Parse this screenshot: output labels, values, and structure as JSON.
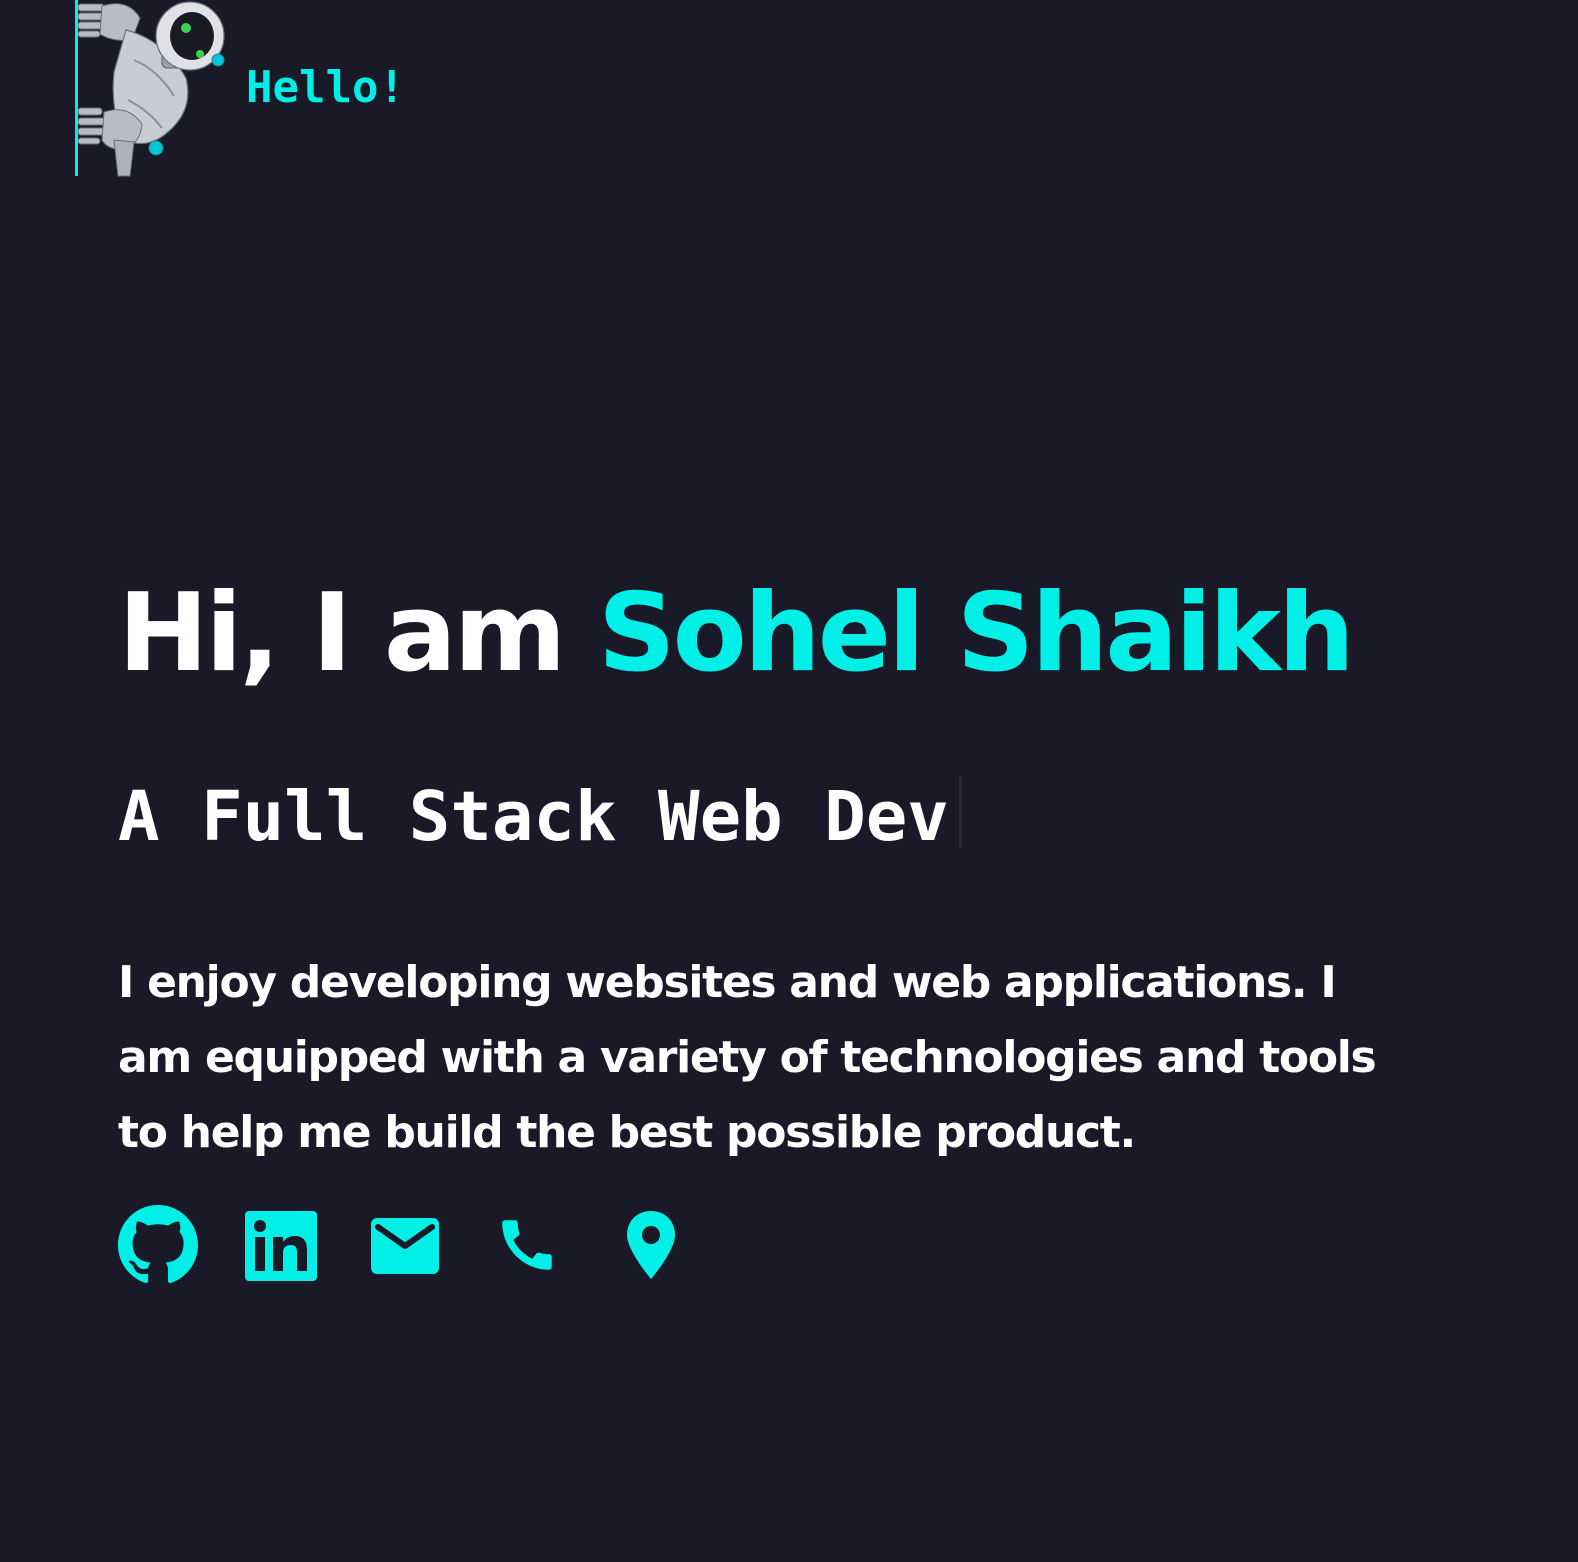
{
  "header": {
    "greeting": "Hello!",
    "mascot_icon": "peeking-robot-icon"
  },
  "hero": {
    "title_prefix": "Hi, I am ",
    "title_name": "Sohel Shaikh",
    "subtitle": "A Full Stack Web Dev",
    "bio": "I enjoy developing websites and web applications. I am equipped with a variety of technologies and tools to help me build the best possible product."
  },
  "socials": [
    {
      "icon": "github-icon"
    },
    {
      "icon": "linkedin-icon"
    },
    {
      "icon": "mail-icon"
    },
    {
      "icon": "phone-icon"
    },
    {
      "icon": "location-pin-icon"
    }
  ],
  "colors": {
    "background": "#191927",
    "accent": "#00f0e8",
    "text": "#ffffff"
  }
}
